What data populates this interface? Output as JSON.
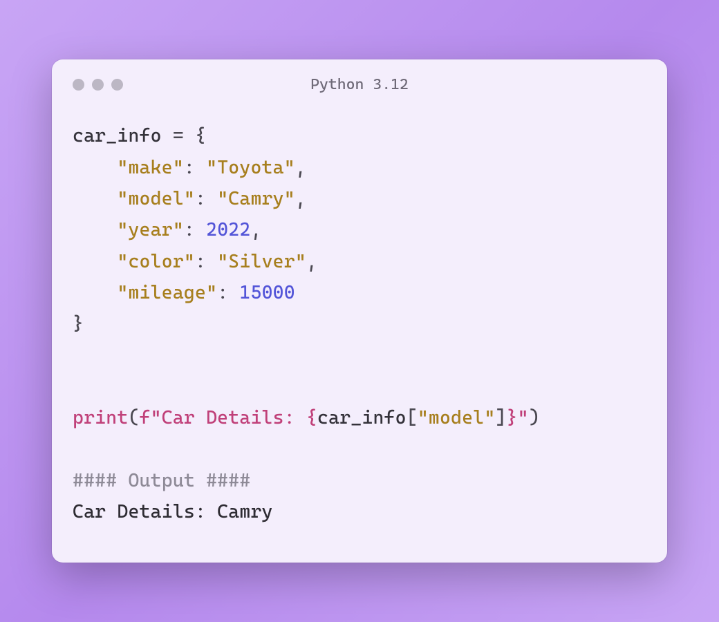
{
  "window": {
    "title": "Python 3.12"
  },
  "code": {
    "line1": {
      "var": "car_info",
      "assign": " = {"
    },
    "entries": [
      {
        "key": "\"make\"",
        "colon": ": ",
        "val": "\"Toyota\"",
        "type": "string",
        "trail": ","
      },
      {
        "key": "\"model\"",
        "colon": ": ",
        "val": "\"Camry\"",
        "type": "string",
        "trail": ","
      },
      {
        "key": "\"year\"",
        "colon": ": ",
        "val": "2022",
        "type": "number",
        "trail": ","
      },
      {
        "key": "\"color\"",
        "colon": ": ",
        "val": "\"Silver\"",
        "type": "string",
        "trail": ","
      },
      {
        "key": "\"mileage\"",
        "colon": ": ",
        "val": "15000",
        "type": "number",
        "trail": ""
      }
    ],
    "close_brace": "}",
    "print": {
      "func": "print",
      "open_paren": "(",
      "f_prefix": "f\"",
      "literal1": "Car Details: ",
      "expr_open": "{",
      "expr_var": "car_info",
      "expr_bracket_open": "[",
      "expr_key": "\"model\"",
      "expr_bracket_close": "]",
      "expr_close": "}",
      "f_close": "\"",
      "close_paren": ")"
    },
    "output_header": "#### Output ####",
    "output_line": "Car Details: Camry",
    "indent": "    "
  }
}
